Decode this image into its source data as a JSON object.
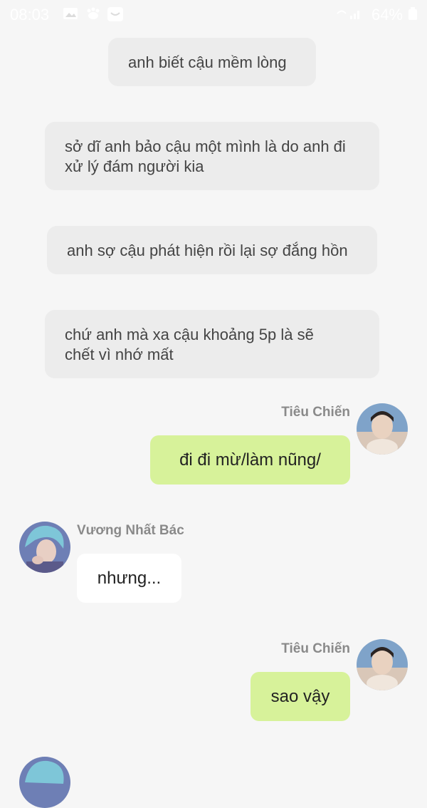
{
  "status_bar": {
    "time": "08:03",
    "battery": "64%",
    "icons": [
      "image-icon",
      "paw-icon",
      "message-icon",
      "signal-icon",
      "battery-icon"
    ]
  },
  "narration": [
    {
      "lines": [
        "anh biết cậu mềm lòng"
      ]
    },
    {
      "lines": [
        "sở dĩ anh bảo cậu một mình là do anh đi",
        "xử lý đám người kia"
      ]
    },
    {
      "lines": [
        "anh sợ cậu phát hiện rồi lại sợ đắng hồn"
      ]
    },
    {
      "lines": [
        "chứ anh mà xa cậu khoảng 5p là sẽ",
        "chết vì nhớ mất"
      ]
    }
  ],
  "messages": [
    {
      "sender": "Tiêu Chiến",
      "text": "đi đi mừ/làm nũng/",
      "side": "right"
    },
    {
      "sender": "Vương Nhất Bác",
      "text": "nhưng...",
      "side": "left"
    },
    {
      "sender": "Tiêu Chiến",
      "text": "sao vậy",
      "side": "right"
    }
  ],
  "colors": {
    "background": "#f6f6f6",
    "narration_bubble": "#ececec",
    "right_bubble": "#d7f29a",
    "left_bubble": "#ffffff",
    "sender_name": "#8a8a8a"
  }
}
